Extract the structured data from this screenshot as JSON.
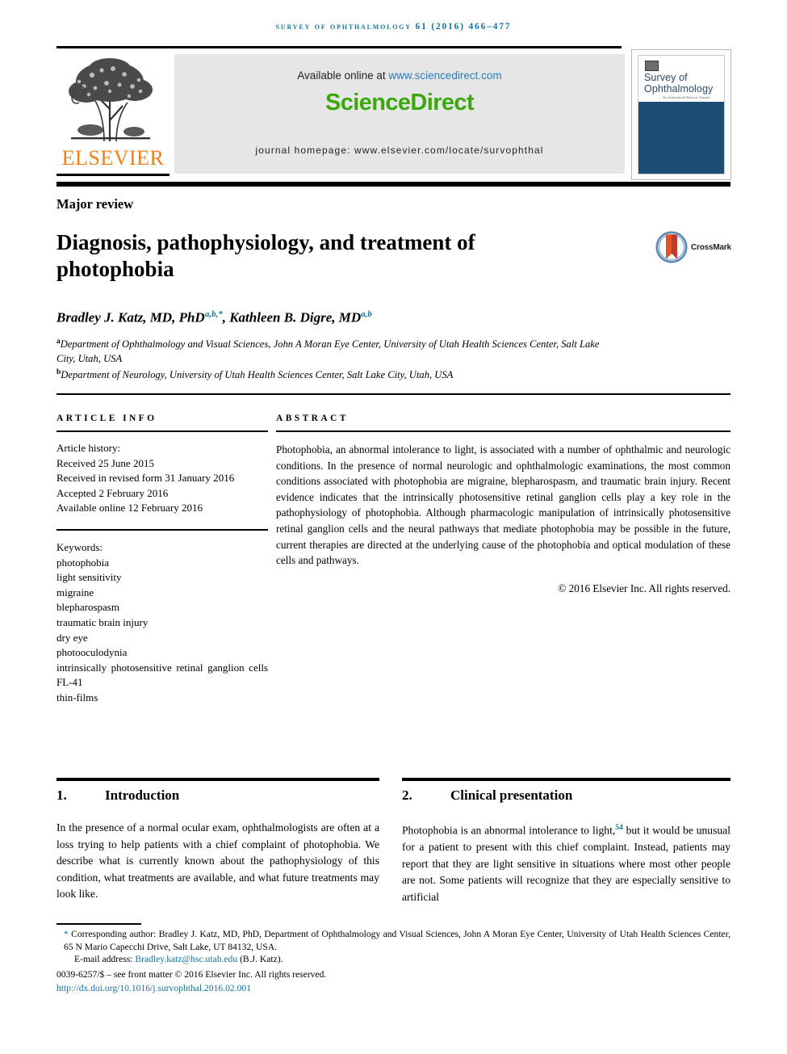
{
  "running_head": "Survey of Ophthalmology 61 (2016) 466–477",
  "masthead": {
    "publisher_name": "ELSEVIER",
    "available_text": "Available online at ",
    "available_url": "www.sciencedirect.com",
    "sciencedirect_logo": "ScienceDirect",
    "journal_homepage": "journal homepage: www.elsevier.com/locate/survophthal",
    "cover": {
      "title_line1": "Survey of",
      "title_line2": "Ophthalmology",
      "subtitle": "An Internationl Review Journal"
    }
  },
  "article": {
    "type_label": "Major review",
    "title": "Diagnosis, pathophysiology, and treatment of photophobia",
    "crossmark_label": "CrossMark",
    "authors_html": "Bradley J. Katz, MD, PhD<sup>a,b,*</sup>, Kathleen B. Digre, MD<sup>a,b</sup>",
    "affiliations": [
      {
        "marker": "a",
        "text": "Department of Ophthalmology and Visual Sciences, John A Moran Eye Center, University of Utah Health Sciences Center, Salt Lake City, Utah, USA"
      },
      {
        "marker": "b",
        "text": "Department of Neurology, University of Utah Health Sciences Center, Salt Lake City, Utah, USA"
      }
    ]
  },
  "article_info": {
    "heading": "ARTICLE INFO",
    "history_label": "Article history:",
    "history": [
      "Received 25 June 2015",
      "Received in revised form 31 January 2016",
      "Accepted 2 February 2016",
      "Available online 12 February 2016"
    ],
    "keywords_label": "Keywords:",
    "keywords": [
      "photophobia",
      "light sensitivity",
      "migraine",
      "blepharospasm",
      "traumatic brain injury",
      "dry eye",
      "photooculodynia",
      "intrinsically photosensitive retinal ganglion cells",
      "FL-41",
      "thin-films"
    ]
  },
  "abstract": {
    "heading": "ABSTRACT",
    "text": "Photophobia, an abnormal intolerance to light, is associated with a number of ophthalmic and neurologic conditions. In the presence of normal neurologic and ophthalmologic examinations, the most common conditions associated with photophobia are migraine, blepharospasm, and traumatic brain injury. Recent evidence indicates that the intrinsically photosensitive retinal ganglion cells play a key role in the pathophysiology of photophobia. Although pharmacologic manipulation of intrinsically photosensitive retinal ganglion cells and the neural pathways that mediate photophobia may be possible in the future, current therapies are directed at the underlying cause of the photophobia and optical modulation of these cells and pathways.",
    "copyright": "© 2016 Elsevier Inc. All rights reserved."
  },
  "sections": [
    {
      "number": "1.",
      "title": "Introduction",
      "body_html": "In the presence of a normal ocular exam, ophthalmologists are often at a loss trying to help patients with a chief complaint of photophobia. We describe what is currently known about the pathophysiology of this condition, what treatments are available, and what future treatments may look like."
    },
    {
      "number": "2.",
      "title": "Clinical presentation",
      "body_html": "Photophobia is an abnormal intolerance to light,<sup>54</sup> but it would be unusual for a patient to present with this chief complaint. Instead, patients may report that they are light sensitive in situations where most other people are not. Some patients will recognize that they are especially sensitive to artificial"
    }
  ],
  "footer": {
    "corresponding_html": "<span class=\"lnk\">*</span> Corresponding author: Bradley J. Katz, MD, PhD, Department of Ophthalmology and Visual Sciences, John A Moran Eye Center, University of Utah Health Sciences Center, 65 N Mario Capecchi Drive, Salt Lake, UT 84132, USA.",
    "email_label": "E-mail address:",
    "email": "Bradley.katz@hsc.utah.edu",
    "email_suffix": "(B.J. Katz).",
    "issn_line": "0039-6257/$ – see front matter © 2016 Elsevier Inc. All rights reserved.",
    "doi": "http://dx.doi.org/10.1016/j.survophthal.2016.02.001"
  },
  "colors": {
    "link_blue": "#1572a0",
    "sciencedirect_green": "#3aa80a",
    "elsevier_orange": "#f07f1a",
    "cover_navy": "#1d4d72"
  }
}
